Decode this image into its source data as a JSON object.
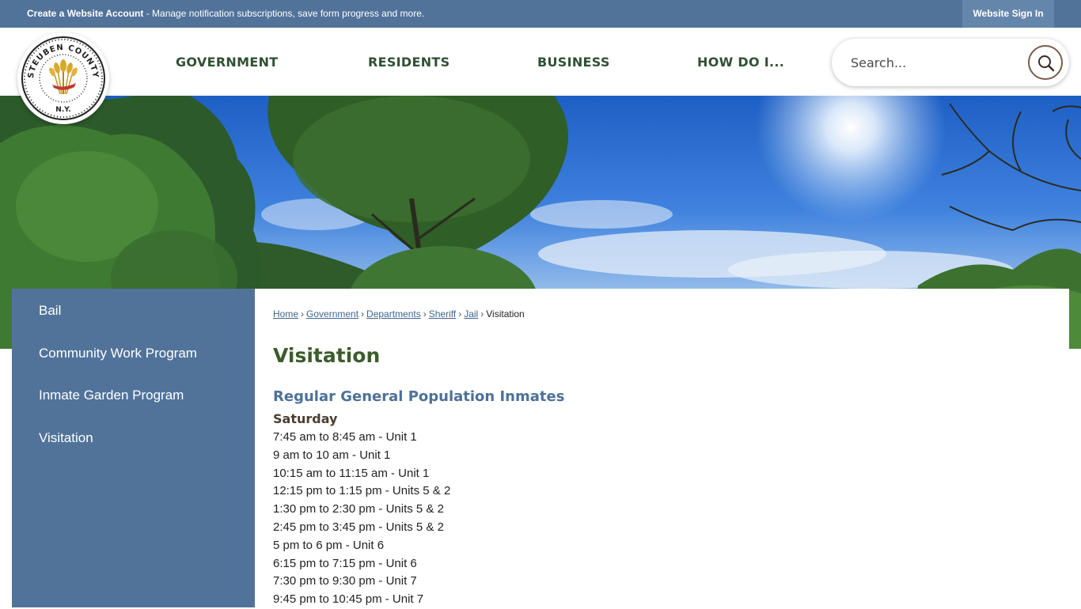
{
  "topbar": {
    "account_link": "Create a Website Account",
    "account_desc": " - Manage notification subscriptions, save form progress and more.",
    "signin": "Website Sign In"
  },
  "logo": {
    "arc_text": "STEUBEN COUNTY",
    "state_text": "N.Y.",
    "colors": {
      "ring": "#222222",
      "wheat": "#d9a72a",
      "ribbon": "#c0392b"
    }
  },
  "nav": {
    "items": [
      {
        "label": "GOVERNMENT"
      },
      {
        "label": "RESIDENTS"
      },
      {
        "label": "BUSINESS"
      },
      {
        "label": "HOW DO I..."
      }
    ]
  },
  "search": {
    "placeholder": "Search...",
    "icon": "search-icon"
  },
  "sidebar": {
    "items": [
      {
        "label": "Bail"
      },
      {
        "label": "Community Work Program"
      },
      {
        "label": "Inmate Garden Program"
      },
      {
        "label": "Visitation"
      }
    ]
  },
  "breadcrumb": {
    "items": [
      "Home",
      "Government",
      "Departments",
      "Sheriff",
      "Jail"
    ],
    "current": "Visitation"
  },
  "page": {
    "title": "Visitation",
    "section_title": "Regular General Population Inmates",
    "day": "Saturday",
    "slots": [
      "7:45 am to 8:45 am - Unit 1",
      "9 am to 10 am - Unit 1",
      "10:15 am to 11:15 am - Unit 1",
      "12:15 pm to 1:15 pm - Units 5 & 2",
      "1:30 pm to 2:30 pm - Units 5 & 2",
      "2:45 pm to 3:45 pm - Units 5 & 2",
      "5 pm to 6 pm - Unit 6",
      "6:15 pm to 7:15 pm - Unit 6",
      "7:30 pm to 9:30 pm - Unit 7",
      "9:45 pm to 10:45 pm - Unit 7"
    ]
  },
  "colors": {
    "topbar": "#51739a",
    "sidebar": "#51739a",
    "nav_text": "#2f5133",
    "title": "#3c5c2c",
    "section_title": "#4d7199",
    "link": "#3f6691"
  }
}
